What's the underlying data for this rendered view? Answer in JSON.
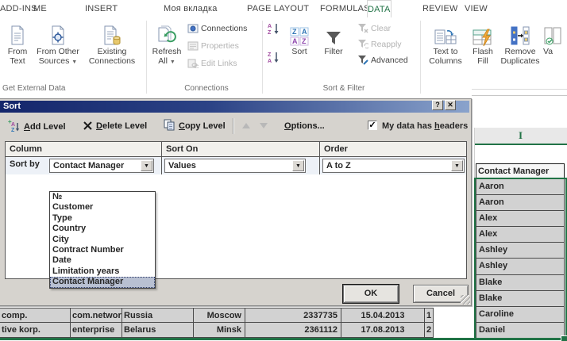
{
  "ribbon": {
    "tabs": [
      {
        "label": "ME",
        "active": false
      },
      {
        "label": "INSERT",
        "active": false
      },
      {
        "label": "Моя вкладка",
        "active": false
      },
      {
        "label": "PAGE LAYOUT",
        "active": false
      },
      {
        "label": "FORMULAS",
        "active": false
      },
      {
        "label": "DATA",
        "active": true
      },
      {
        "label": "REVIEW",
        "active": false
      },
      {
        "label": "VIEW",
        "active": false
      },
      {
        "label": "ADD-INS",
        "active": false
      }
    ],
    "groups": {
      "get_external_data": {
        "label": "Get External Data",
        "from_text": {
          "l1": "From",
          "l2": "Text"
        },
        "from_other": {
          "l1": "From Other",
          "l2": "Sources"
        },
        "existing": {
          "l1": "Existing",
          "l2": "Connections"
        }
      },
      "connections": {
        "label": "Connections",
        "refresh": {
          "l1": "Refresh",
          "l2": "All"
        },
        "connections": "Connections",
        "properties": "Properties",
        "edit_links": "Edit Links"
      },
      "sort_filter": {
        "label": "Sort & Filter",
        "sort": "Sort",
        "filter": "Filter",
        "clear": "Clear",
        "reapply": "Reapply",
        "advanced": "Advanced"
      },
      "data_tools": {
        "text_to_columns": {
          "l1": "Text to",
          "l2": "Columns"
        },
        "flash_fill": {
          "l1": "Flash",
          "l2": "Fill"
        },
        "remove_duplicates": {
          "l1": "Remove",
          "l2": "Duplicates"
        },
        "partial": "Va"
      }
    },
    "colors": {
      "accent_green": "#217346"
    }
  },
  "dialog": {
    "title": "Sort",
    "toolbar": {
      "add": {
        "u": "A",
        "rest": "dd Level"
      },
      "del": {
        "u": "D",
        "rest": "elete Level"
      },
      "copy": {
        "u": "C",
        "rest": "opy Level"
      },
      "options": {
        "u": "O",
        "rest": "ptions..."
      },
      "headers": {
        "pre": "My data has ",
        "u": "h",
        "rest": "eaders"
      },
      "headers_checked": true,
      "check_glyph": "✓"
    },
    "grid": {
      "col1": "Column",
      "col2": "Sort On",
      "col3": "Order",
      "row_label": "Sort by",
      "column_value": "Contact Manager",
      "sort_on_value": "Values",
      "order_value": "A to Z"
    },
    "dropdown": {
      "items": [
        "№",
        "Customer",
        "Type",
        "Country",
        "City",
        "Contract Number",
        "Date",
        "Limitation years",
        "Contact Manager"
      ],
      "selected": "Contact Manager"
    },
    "ok": "OK",
    "cancel": "Cancel"
  },
  "sheet": {
    "col_letter": "I",
    "table_header": "Contact Manager",
    "names": [
      "Aaron",
      "Aaron",
      "Alex",
      "Alex",
      "Ashley",
      "Ashley",
      "Blake",
      "Blake",
      "Caroline",
      "Daniel"
    ],
    "bottom_rows": [
      [
        "comp.",
        "com.network",
        "Russia",
        "Moscow",
        "2337735",
        "15.04.2013",
        "1"
      ],
      [
        "tive korp.",
        "enterprise",
        "Belarus",
        "Minsk",
        "2361112",
        "17.08.2013",
        "2"
      ]
    ]
  }
}
